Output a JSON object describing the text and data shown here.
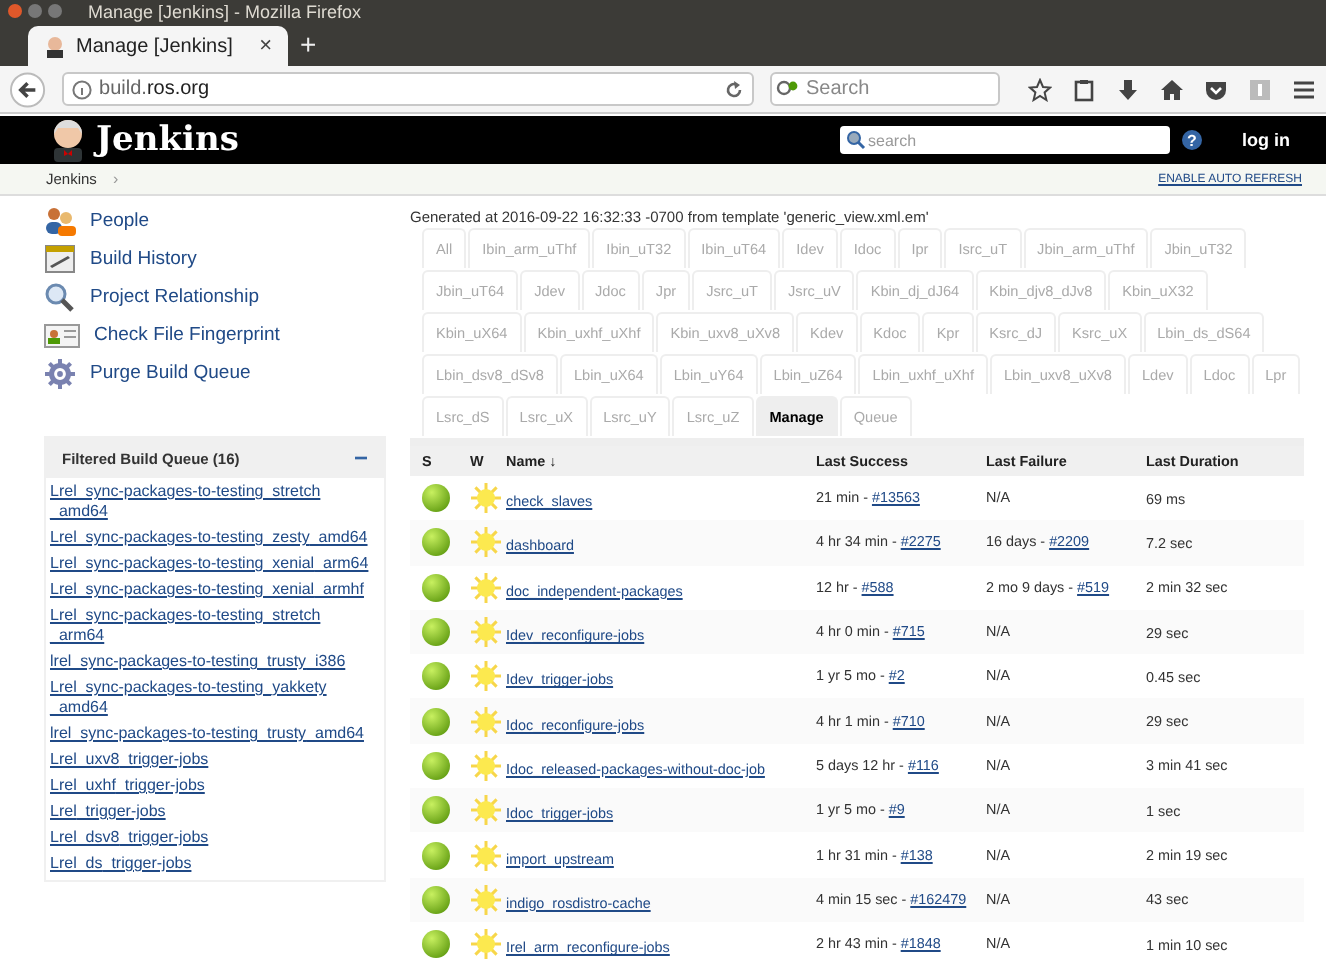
{
  "window": {
    "title": "Manage [Jenkins] - Mozilla Firefox"
  },
  "browser": {
    "tab": {
      "title": "Manage [Jenkins]",
      "close": "×"
    },
    "new_tab": "+",
    "url": "build.**ros.org**",
    "search": {
      "placeholder": "Search"
    }
  },
  "header": {
    "logo": "Jenkins",
    "search": {
      "placeholder": "search"
    },
    "help": "?",
    "login": "log in"
  },
  "breadcrumb": {
    "items": [
      "Jenkins"
    ],
    "separator": "›",
    "auto_refresh": "ENABLE AUTO REFRESH"
  },
  "sidebar": {
    "tasks": [
      {
        "kind": "people",
        "label": "People"
      },
      {
        "kind": "history",
        "label": "Build History"
      },
      {
        "kind": "search",
        "label": "Project Relationship"
      },
      {
        "kind": "fingerprint",
        "label": "Check File Fingerprint"
      },
      {
        "kind": "gear",
        "label": "Purge Build Queue"
      }
    ]
  },
  "build_queue": {
    "title": "Filtered Build Queue (16)",
    "collapse": "−",
    "items": [
      "Lrel_sync-packages-to-testing_stretch_amd64",
      "Lrel_sync-packages-to-testing_zesty_amd64",
      "Lrel_sync-packages-to-testing_xenial_arm64",
      "Lrel_sync-packages-to-testing_xenial_armhf",
      "Lrel_sync-packages-to-testing_stretch_arm64",
      "lrel_sync-packages-to-testing_trusty_i386",
      "Lrel_sync-packages-to-testing_yakkety_amd64",
      "lrel_sync-packages-to-testing_trusty_amd64",
      "Lrel_uxv8_trigger-jobs",
      "Lrel_uxhf_trigger-jobs",
      "Lrel_trigger-jobs",
      "Lrel_dsv8_trigger-jobs",
      "Lrel_ds_trigger-jobs"
    ]
  },
  "view": {
    "generated": "Generated at 2016-09-22 16:32:33 -0700 from template 'generic_view.xml.em'",
    "tabs": [
      {
        "label": "All",
        "selected": false
      },
      {
        "label": "Ibin_arm_uThf",
        "selected": false
      },
      {
        "label": "Ibin_uT32",
        "selected": false
      },
      {
        "label": "Ibin_uT64",
        "selected": false
      },
      {
        "label": "Idev",
        "selected": false
      },
      {
        "label": "Idoc",
        "selected": false
      },
      {
        "label": "Ipr",
        "selected": false
      },
      {
        "label": "Isrc_uT",
        "selected": false
      },
      {
        "label": "Jbin_arm_uThf",
        "selected": false
      },
      {
        "label": "Jbin_uT32",
        "selected": false
      },
      {
        "label": "Jbin_uT64",
        "selected": false
      },
      {
        "label": "Jdev",
        "selected": false
      },
      {
        "label": "Jdoc",
        "selected": false
      },
      {
        "label": "Jpr",
        "selected": false
      },
      {
        "label": "Jsrc_uT",
        "selected": false
      },
      {
        "label": "Jsrc_uV",
        "selected": false
      },
      {
        "label": "Kbin_dj_dJ64",
        "selected": false
      },
      {
        "label": "Kbin_djv8_dJv8",
        "selected": false
      },
      {
        "label": "Kbin_uX32",
        "selected": false
      },
      {
        "label": "Kbin_uX64",
        "selected": false
      },
      {
        "label": "Kbin_uxhf_uXhf",
        "selected": false
      },
      {
        "label": "Kbin_uxv8_uXv8",
        "selected": false
      },
      {
        "label": "Kdev",
        "selected": false
      },
      {
        "label": "Kdoc",
        "selected": false
      },
      {
        "label": "Kpr",
        "selected": false
      },
      {
        "label": "Ksrc_dJ",
        "selected": false
      },
      {
        "label": "Ksrc_uX",
        "selected": false
      },
      {
        "label": "Lbin_ds_dS64",
        "selected": false
      },
      {
        "label": "Lbin_dsv8_dSv8",
        "selected": false
      },
      {
        "label": "Lbin_uX64",
        "selected": false
      },
      {
        "label": "Lbin_uY64",
        "selected": false
      },
      {
        "label": "Lbin_uZ64",
        "selected": false
      },
      {
        "label": "Lbin_uxhf_uXhf",
        "selected": false
      },
      {
        "label": "Lbin_uxv8_uXv8",
        "selected": false
      },
      {
        "label": "Ldev",
        "selected": false
      },
      {
        "label": "Ldoc",
        "selected": false
      },
      {
        "label": "Lpr",
        "selected": false
      },
      {
        "label": "Lsrc_dS",
        "selected": false
      },
      {
        "label": "Lsrc_uX",
        "selected": false
      },
      {
        "label": "Lsrc_uY",
        "selected": false
      },
      {
        "label": "Lsrc_uZ",
        "selected": false
      },
      {
        "label": "Manage",
        "selected": true
      },
      {
        "label": "Queue",
        "selected": false
      }
    ],
    "table": {
      "columns": [
        "S",
        "W",
        "Name ↓",
        "Last Success",
        "Last Failure",
        "Last Duration"
      ],
      "rows": [
        {
          "name": "check_slaves",
          "last_success": {
            "text": "21 min - ",
            "build": "#13563"
          },
          "last_failure": {
            "text": "N/A"
          },
          "duration": "69 ms"
        },
        {
          "name": "dashboard",
          "last_success": {
            "text": "4 hr 34 min - ",
            "build": "#2275"
          },
          "last_failure": {
            "text": "16 days - ",
            "build": "#2209"
          },
          "duration": "7.2 sec"
        },
        {
          "name": "doc_independent-packages",
          "last_success": {
            "text": "12 hr - ",
            "build": "#588"
          },
          "last_failure": {
            "text": "2 mo 9 days - ",
            "build": "#519"
          },
          "duration": "2 min 32 sec"
        },
        {
          "name": "Idev_reconfigure-jobs",
          "last_success": {
            "text": "4 hr 0 min - ",
            "build": "#715"
          },
          "last_failure": {
            "text": "N/A"
          },
          "duration": "29 sec"
        },
        {
          "name": "Idev_trigger-jobs",
          "last_success": {
            "text": "1 yr 5 mo - ",
            "build": "#2"
          },
          "last_failure": {
            "text": "N/A"
          },
          "duration": "0.45 sec"
        },
        {
          "name": "Idoc_reconfigure-jobs",
          "last_success": {
            "text": "4 hr 1 min - ",
            "build": "#710"
          },
          "last_failure": {
            "text": "N/A"
          },
          "duration": "29 sec"
        },
        {
          "name": "Idoc_released-packages-without-doc-job",
          "last_success": {
            "text": "5 days 12 hr - ",
            "build": "#116"
          },
          "last_failure": {
            "text": "N/A"
          },
          "duration": "3 min 41 sec"
        },
        {
          "name": "Idoc_trigger-jobs",
          "last_success": {
            "text": "1 yr 5 mo - ",
            "build": "#9"
          },
          "last_failure": {
            "text": "N/A"
          },
          "duration": "1 sec"
        },
        {
          "name": "import_upstream",
          "last_success": {
            "text": "1 hr 31 min - ",
            "build": "#138"
          },
          "last_failure": {
            "text": "N/A"
          },
          "duration": "2 min 19 sec"
        },
        {
          "name": "indigo_rosdistro-cache",
          "last_success": {
            "text": "4 min 15 sec - ",
            "build": "#162479"
          },
          "last_failure": {
            "text": "N/A"
          },
          "duration": "43 sec"
        },
        {
          "name": "Irel_arm_reconfigure-jobs",
          "last_success": {
            "text": "2 hr 43 min - ",
            "build": "#1848"
          },
          "last_failure": {
            "text": "N/A"
          },
          "duration": "1 min 10 sec"
        }
      ]
    }
  }
}
